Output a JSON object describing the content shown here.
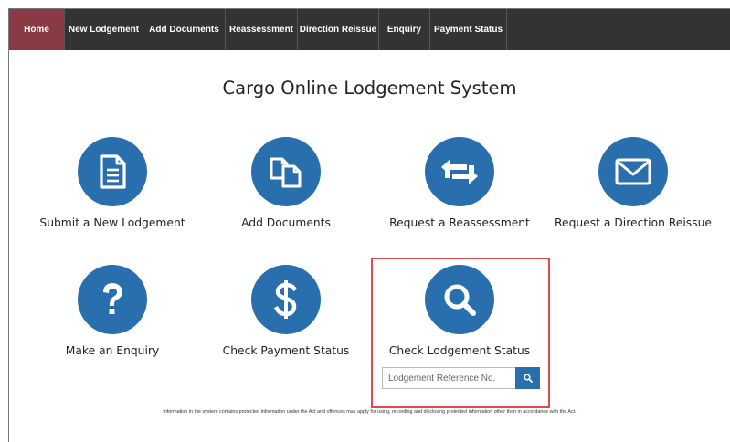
{
  "nav": {
    "items": [
      {
        "label": "Home",
        "active": true
      },
      {
        "label": "New Lodgement"
      },
      {
        "label": "Add Documents"
      },
      {
        "label": "Reassessment"
      },
      {
        "label": "Direction Reissue"
      },
      {
        "label": "Enquiry"
      },
      {
        "label": "Payment Status"
      }
    ]
  },
  "page": {
    "title": "Cargo Online Lodgement System"
  },
  "tiles": [
    {
      "label": "Submit a New Lodgement",
      "icon": "document-icon"
    },
    {
      "label": "Add Documents",
      "icon": "copy-documents-icon"
    },
    {
      "label": "Request a Reassessment",
      "icon": "swap-arrows-icon"
    },
    {
      "label": "Request a Direction Reissue",
      "icon": "envelope-icon"
    },
    {
      "label": "Make an Enquiry",
      "icon": "question-icon"
    },
    {
      "label": "Check Payment Status",
      "icon": "dollar-icon"
    },
    {
      "label": "Check Lodgement Status",
      "icon": "magnifier-icon"
    }
  ],
  "search": {
    "placeholder": "Lodgement Reference No.",
    "value": ""
  },
  "footer": {
    "note": "Information in the system contains protected information under the Act and offences may apply for using, recording and disclosing protected information other than in accordance with the Act."
  },
  "colors": {
    "nav_bg": "#333333",
    "nav_active": "#8a3a44",
    "accent": "#2a6fad",
    "highlight": "#e04a4a"
  }
}
